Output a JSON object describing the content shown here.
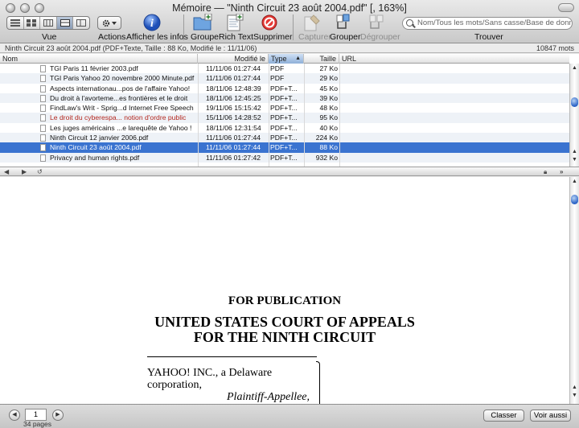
{
  "window": {
    "title": "Mémoire — \"Ninth Circuit 23 août 2004.pdf\" [, 163%]"
  },
  "toolbar": {
    "view_label": "Vue",
    "actions_label": "Actions",
    "info_label": "Afficher les infos",
    "group_label": "Groupe",
    "richtext_label": "Rich Text",
    "delete_label": "Supprimer",
    "capture_label": "Capturer",
    "grouper_label": "Grouper",
    "ungroup_label": "Dégrouper",
    "find_label": "Trouver",
    "search_placeholder": "Nom/Tous les mots/Sans casse/Base de données"
  },
  "infobar": {
    "details": "Ninth Circuit 23 août 2004.pdf (PDF+Texte, Taille : 88 Ko, Modifié le : 11/11/06)",
    "word_count": "10847 mots"
  },
  "table": {
    "columns": [
      "Nom",
      "Modifié le",
      "Type",
      "Taille",
      "URL"
    ],
    "sorted_column": "Type",
    "rows": [
      {
        "name": "TGI Paris 11 février 2003.pdf",
        "modified": "11/11/06 01:27:44",
        "type": "PDF",
        "size": "27 Ko"
      },
      {
        "name": "TGI Paris Yahoo 20 novembre 2000 Minute.pdf",
        "modified": "11/11/06 01:27:44",
        "type": "PDF",
        "size": "29 Ko"
      },
      {
        "name": "Aspects internationau...pos de l'affaire Yahoo!",
        "modified": "18/11/06 12:48:39",
        "type": "PDF+T...",
        "size": "45 Ko"
      },
      {
        "name": "Du droit à l'avorteme...es frontières et le droit",
        "modified": "18/11/06 12:45:25",
        "type": "PDF+T...",
        "size": "39 Ko"
      },
      {
        "name": "FindLaw's Writ - Sprig...d Internet Free Speech",
        "modified": "19/11/06 15:15:42",
        "type": "PDF+T...",
        "size": "48 Ko"
      },
      {
        "name": "Le droit du cyberespa... notion d'ordre public",
        "modified": "15/11/06 14:28:52",
        "type": "PDF+T...",
        "size": "95 Ko"
      },
      {
        "name": "Les juges américains ...e larequête de Yahoo !",
        "modified": "18/11/06 12:31:54",
        "type": "PDF+T...",
        "size": "40 Ko"
      },
      {
        "name": "Ninth Circuit 12 janvier 2006.pdf",
        "modified": "11/11/06 01:27:44",
        "type": "PDF+T...",
        "size": "224 Ko"
      },
      {
        "name": "Ninth Circuit 23 août 2004.pdf",
        "modified": "11/11/06 01:27:44",
        "type": "PDF+T...",
        "size": "88 Ko"
      },
      {
        "name": "Privacy and human rights.pdf",
        "modified": "11/11/06 01:27:42",
        "type": "PDF+T...",
        "size": "932 Ko"
      }
    ],
    "selected_row": 8,
    "red_row": 5
  },
  "document": {
    "heading1": "FOR PUBLICATION",
    "heading2": "UNITED STATES COURT OF APPEALS",
    "heading3": "FOR THE NINTH CIRCUIT",
    "party_line1": "YAHOO! INC., a Delaware",
    "party_line2": "corporation,",
    "party_role": "Plaintiff-Appellee,"
  },
  "footer": {
    "page_value": "1",
    "page_count": "34 pages",
    "classify_label": "Classer",
    "see_also_label": "Voir aussi"
  },
  "colors": {
    "selection": "#3a73d0",
    "sort_header": "#8fb0d8",
    "red_text": "#b3261e"
  }
}
